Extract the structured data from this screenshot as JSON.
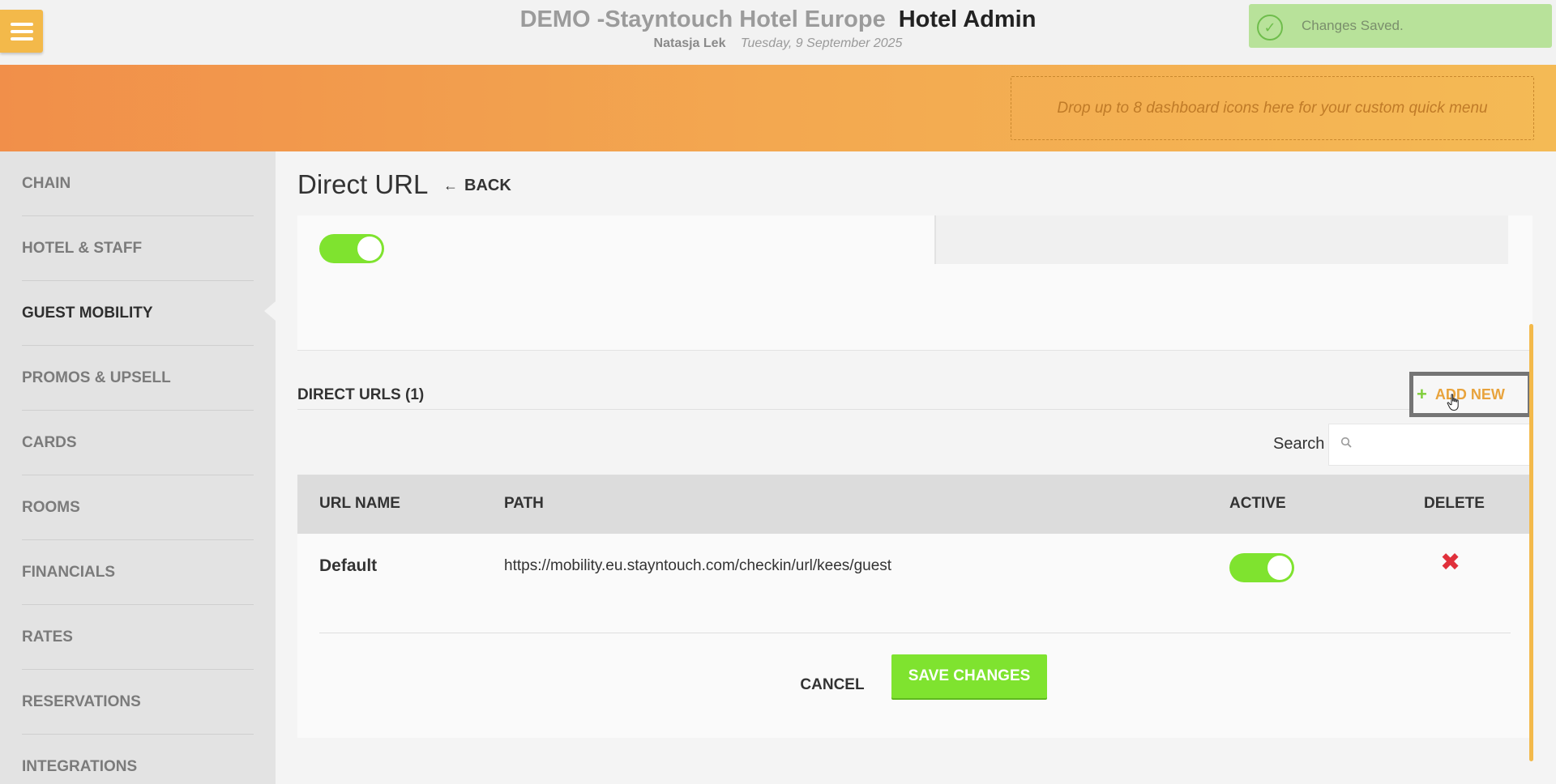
{
  "header": {
    "hotel_name": "DEMO -Stayntouch Hotel Europe",
    "app_name": "Hotel Admin",
    "user_name": "Natasja Lek",
    "date": "Tuesday, 9 September 2025"
  },
  "toast": {
    "message": "Changes Saved."
  },
  "quick_menu": {
    "placeholder": "Drop up to 8 dashboard icons here for your custom quick menu"
  },
  "sidebar": {
    "items": [
      {
        "label": "CHAIN"
      },
      {
        "label": "HOTEL & STAFF"
      },
      {
        "label": "GUEST MOBILITY",
        "active": true
      },
      {
        "label": "PROMOS & UPSELL"
      },
      {
        "label": "CARDS"
      },
      {
        "label": "ROOMS"
      },
      {
        "label": "FINANCIALS"
      },
      {
        "label": "RATES"
      },
      {
        "label": "RESERVATIONS"
      },
      {
        "label": "INTEGRATIONS"
      }
    ]
  },
  "page": {
    "title": "Direct URL",
    "back_label": "BACK"
  },
  "settings": {
    "toggle_on": true
  },
  "direct_urls": {
    "heading": "DIRECT URLS (1)",
    "add_new_label": "ADD NEW",
    "search_label": "Search",
    "search_value": "",
    "columns": [
      "URL NAME",
      "PATH",
      "ACTIVE",
      "DELETE"
    ],
    "rows": [
      {
        "name": "Default",
        "path": "https://mobility.eu.stayntouch.com/checkin/url/kees/guest",
        "active": true,
        "delete_icon": "✖"
      }
    ]
  },
  "actions": {
    "cancel_label": "CANCEL",
    "save_label": "SAVE CHANGES"
  },
  "colors": {
    "accent_orange": "#f3b94a",
    "toggle_green": "#7fe32f",
    "delete_red": "#e0303b",
    "add_new_text": "#e8a33c"
  }
}
